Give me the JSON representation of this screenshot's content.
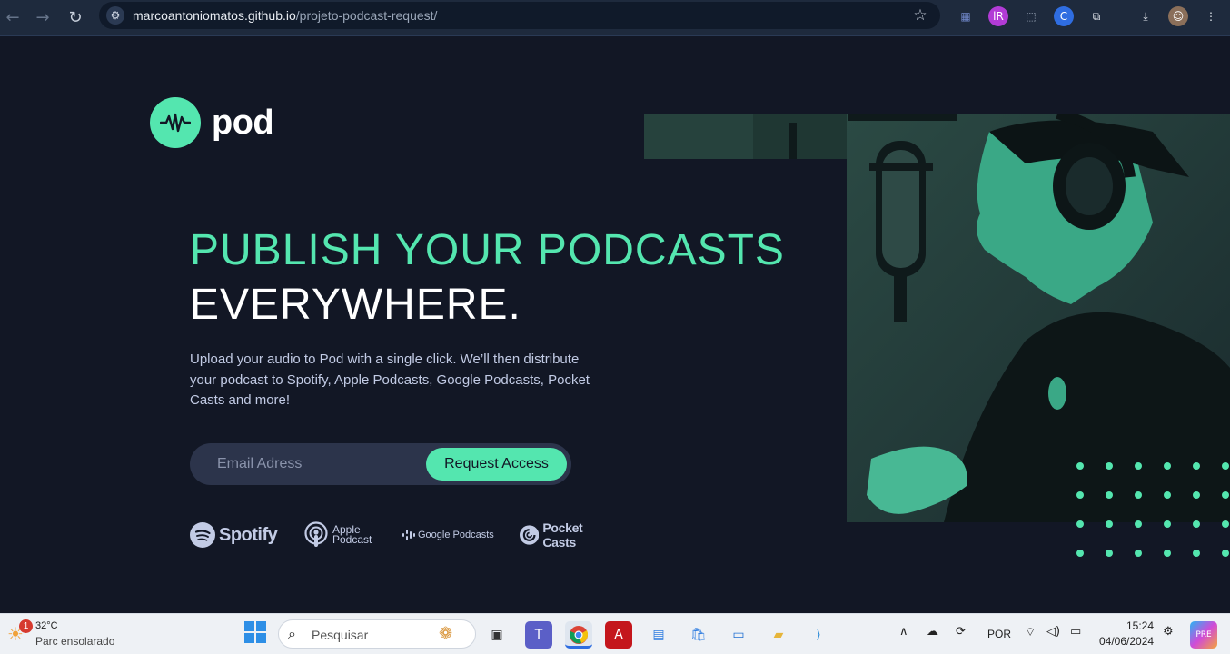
{
  "browser": {
    "url_host": "marcoantoniomatos.github.io",
    "url_path": "/projeto-podcast-request/"
  },
  "page": {
    "logo_text": "pod",
    "headline_green": "PUBLISH YOUR PODCASTS",
    "headline_white": "EVERYWHERE.",
    "description": "Upload your audio to Pod with a single click. We’ll then distribute your podcast to Spotify, Apple Podcasts, Google Podcasts, Pocket Casts and more!",
    "email_placeholder": "Email Adress",
    "request_button": "Request Access",
    "brands": {
      "spotify": "Spotify",
      "apple_line1": "Apple",
      "apple_line2": "Podcast",
      "google": "Google Podcasts",
      "pocket": "Pocket Casts"
    },
    "accent_color": "#54e6af",
    "background_color": "#121725"
  },
  "taskbar": {
    "weather_badge": "1",
    "temperature": "32°C",
    "weather_desc": "Parc ensolarado",
    "search_placeholder": "Pesquisar",
    "language": "POR",
    "time": "15:24",
    "date": "04/06/2024"
  }
}
